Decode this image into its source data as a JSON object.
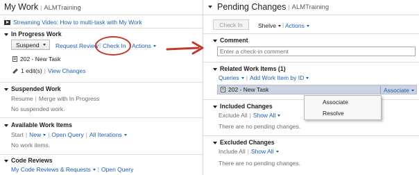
{
  "left": {
    "header": {
      "title": "My Work",
      "subtitle": "ALMTraining"
    },
    "video_link": "Streaming Video: How to multi-task with My Work",
    "in_progress": {
      "title": "In Progress Work",
      "suspend_label": "Suspend",
      "request_review": "Request Review",
      "check_in": "Check In",
      "actions": "Actions",
      "task": "202 - New Task",
      "edits": "1 edit(s)",
      "view_changes": "View Changes"
    },
    "suspended": {
      "title": "Suspended Work",
      "resume": "Resume",
      "merge": "Merge with In Progress",
      "empty": "No suspended work."
    },
    "available": {
      "title": "Available Work Items",
      "start": "Start",
      "new": "New",
      "open_query": "Open Query",
      "all_iterations": "All Iterations",
      "empty": "No work items."
    },
    "code_reviews": {
      "title": "Code Reviews",
      "my_reviews": "My Code Reviews & Requests",
      "open_query": "Open Query"
    }
  },
  "right": {
    "header": {
      "title": "Pending Changes",
      "subtitle": "ALMTraining"
    },
    "toolbar": {
      "check_in": "Check In",
      "shelve": "Shelve",
      "actions": "Actions"
    },
    "comment": {
      "title": "Comment",
      "placeholder": "Enter a check-in comment"
    },
    "related": {
      "title": "Related Work Items (1)",
      "queries": "Queries",
      "add_by_id": "Add Work Item by ID",
      "item": "202 - New Task",
      "associate": "Associate"
    },
    "dropdown": {
      "options": [
        "Associate",
        "Resolve"
      ]
    },
    "included": {
      "title": "Included Changes",
      "exclude_all": "Exclude All",
      "show_all": "Show All",
      "empty": "There are no pending changes."
    },
    "excluded": {
      "title": "Excluded Changes",
      "include_all": "Include All",
      "show_all": "Show All",
      "empty": "There are no pending changes."
    }
  },
  "colors": {
    "link": "#1e5fb4",
    "annotation": "#c0392b",
    "selection": "#cdd3e0"
  }
}
